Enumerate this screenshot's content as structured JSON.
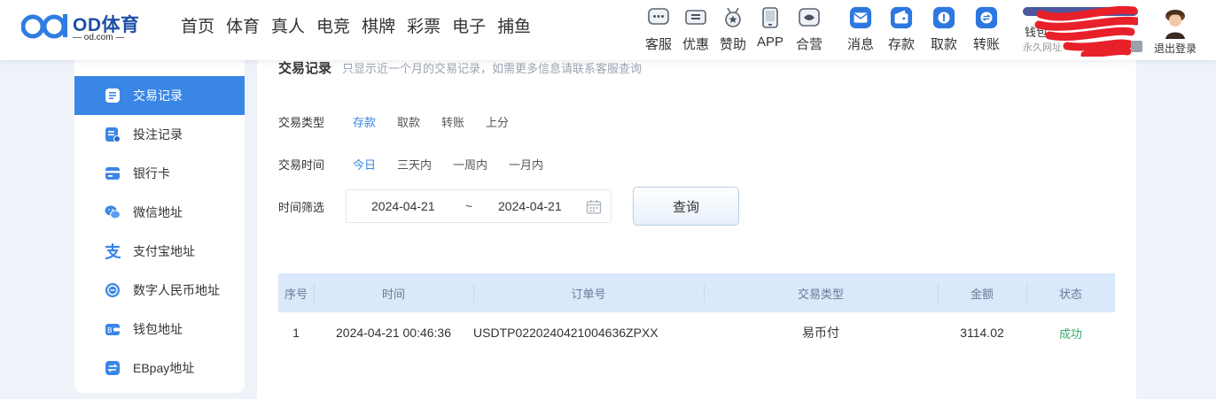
{
  "header": {
    "logo": {
      "name": "OD体育",
      "domain": "— od.com —"
    },
    "nav": [
      "首页",
      "体育",
      "真人",
      "电竞",
      "棋牌",
      "彩票",
      "电子",
      "捕鱼"
    ],
    "quick": [
      "客服",
      "优惠",
      "赞助",
      "APP",
      "合营"
    ],
    "account": [
      "消息",
      "存款",
      "取款",
      "转账"
    ],
    "user": {
      "wallet": "钱包",
      "permanent": "永久网址",
      "logout": "退出登录"
    }
  },
  "sidebar": {
    "items": [
      {
        "label": "交易记录",
        "icon": "record-icon"
      },
      {
        "label": "投注记录",
        "icon": "bet-record-icon"
      },
      {
        "label": "银行卡",
        "icon": "bank-card-icon"
      },
      {
        "label": "微信地址",
        "icon": "wechat-icon"
      },
      {
        "label": "支付宝地址",
        "icon": "alipay-icon"
      },
      {
        "label": "数字人民币地址",
        "icon": "digital-rmb-icon"
      },
      {
        "label": "钱包地址",
        "icon": "wallet-icon"
      },
      {
        "label": "EBpay地址",
        "icon": "ebpay-icon"
      }
    ]
  },
  "content": {
    "title": "交易记录",
    "hint": "只显示近一个月的交易记录，如需更多信息请联系客服查询",
    "type_filter": {
      "label": "交易类型",
      "options": [
        "存款",
        "取款",
        "转账",
        "上分"
      ],
      "selected": "存款"
    },
    "time_filter": {
      "label": "交易时间",
      "options": [
        "今日",
        "三天内",
        "一周内",
        "一月内"
      ],
      "selected": "今日"
    },
    "date_filter": {
      "label": "时间筛选",
      "start": "2024-04-21",
      "separator": "~",
      "end": "2024-04-21"
    },
    "query_button": "查询",
    "table": {
      "headers": [
        "序号",
        "时间",
        "订单号",
        "交易类型",
        "金额",
        "状态"
      ],
      "rows": [
        [
          "1",
          "2024-04-21 00:46:36",
          "USDTP0220240421004636ZPXX",
          "易币付",
          "3114.02",
          "成功"
        ]
      ]
    }
  },
  "colors": {
    "accent": "#3a86e6",
    "success": "#3aa76d",
    "brand": "#1f4fa8"
  }
}
